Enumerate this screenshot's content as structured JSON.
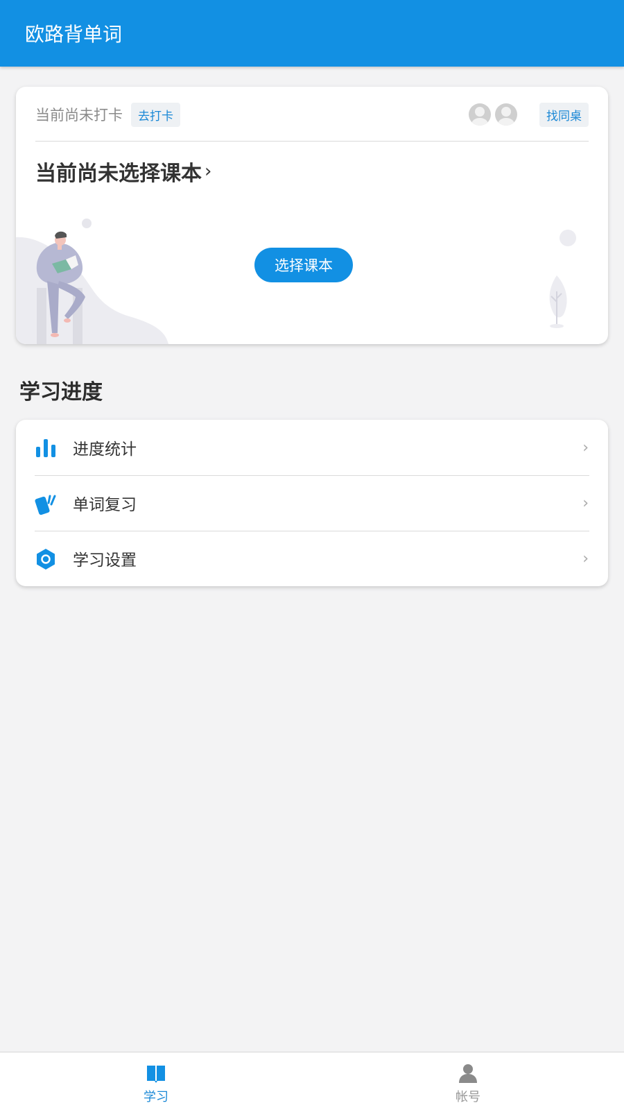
{
  "app_bar": {
    "title": "欧路背单词"
  },
  "checkin_card": {
    "status_text": "当前尚未打卡",
    "checkin_tag": "去打卡",
    "find_deskmate_tag": "找同桌",
    "book_title": "当前尚未选择课本",
    "book_chevron": "›",
    "select_book_button": "选择课本"
  },
  "progress_section": {
    "heading": "学习进度",
    "items": [
      {
        "label": "进度统计",
        "icon": "bar-chart-icon",
        "chevron": "›"
      },
      {
        "label": "单词复习",
        "icon": "cards-icon",
        "chevron": "›"
      },
      {
        "label": "学习设置",
        "icon": "settings-hexagon-icon",
        "chevron": "›"
      }
    ]
  },
  "bottom_nav": {
    "items": [
      {
        "label": "学习",
        "icon": "book-icon",
        "active": true
      },
      {
        "label": "帐号",
        "icon": "person-icon",
        "active": false
      }
    ]
  },
  "colors": {
    "primary": "#1290e3",
    "background": "#f3f3f4",
    "inactive_nav": "#999999"
  }
}
